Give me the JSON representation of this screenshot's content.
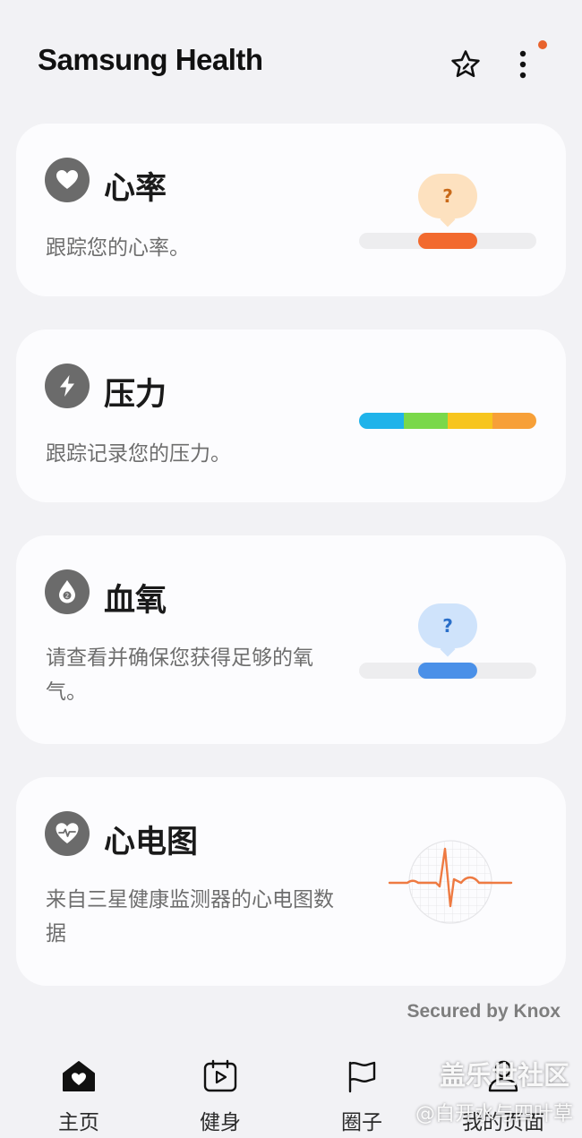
{
  "header": {
    "title": "Samsung Health",
    "star_icon": "star-edit-icon",
    "more_icon": "more-vertical-icon",
    "notification_dot_color": "#e8622c"
  },
  "cards": {
    "heart_rate": {
      "icon": "heart-icon",
      "title": "心率",
      "desc": "跟踪您的心率。",
      "bubble": "?",
      "accent": "#f26a2e"
    },
    "stress": {
      "icon": "lightning-icon",
      "title": "压力",
      "desc": "跟踪记录您的压力。",
      "bar_colors": [
        "#1fb3ea",
        "#7ad84a",
        "#f7c51e",
        "#f7a038"
      ]
    },
    "spo2": {
      "icon": "drop-icon",
      "title": "血氧",
      "desc": "请查看并确保您获得足够的氧气。",
      "bubble": "?",
      "accent": "#4a90e8"
    },
    "ecg": {
      "icon": "heart-pulse-icon",
      "title": "心电图",
      "desc": "来自三星健康监测器的心电图数据"
    }
  },
  "footer": {
    "secured": "Secured by Knox"
  },
  "nav": {
    "items": [
      {
        "label": "主页",
        "icon": "home-heart-icon"
      },
      {
        "label": "健身",
        "icon": "calendar-play-icon"
      },
      {
        "label": "圈子",
        "icon": "flag-icon"
      },
      {
        "label": "我的页面",
        "icon": "person-icon"
      }
    ]
  },
  "watermark": {
    "line1": "盖乐世社区",
    "line2": "@白开水与四叶草"
  }
}
